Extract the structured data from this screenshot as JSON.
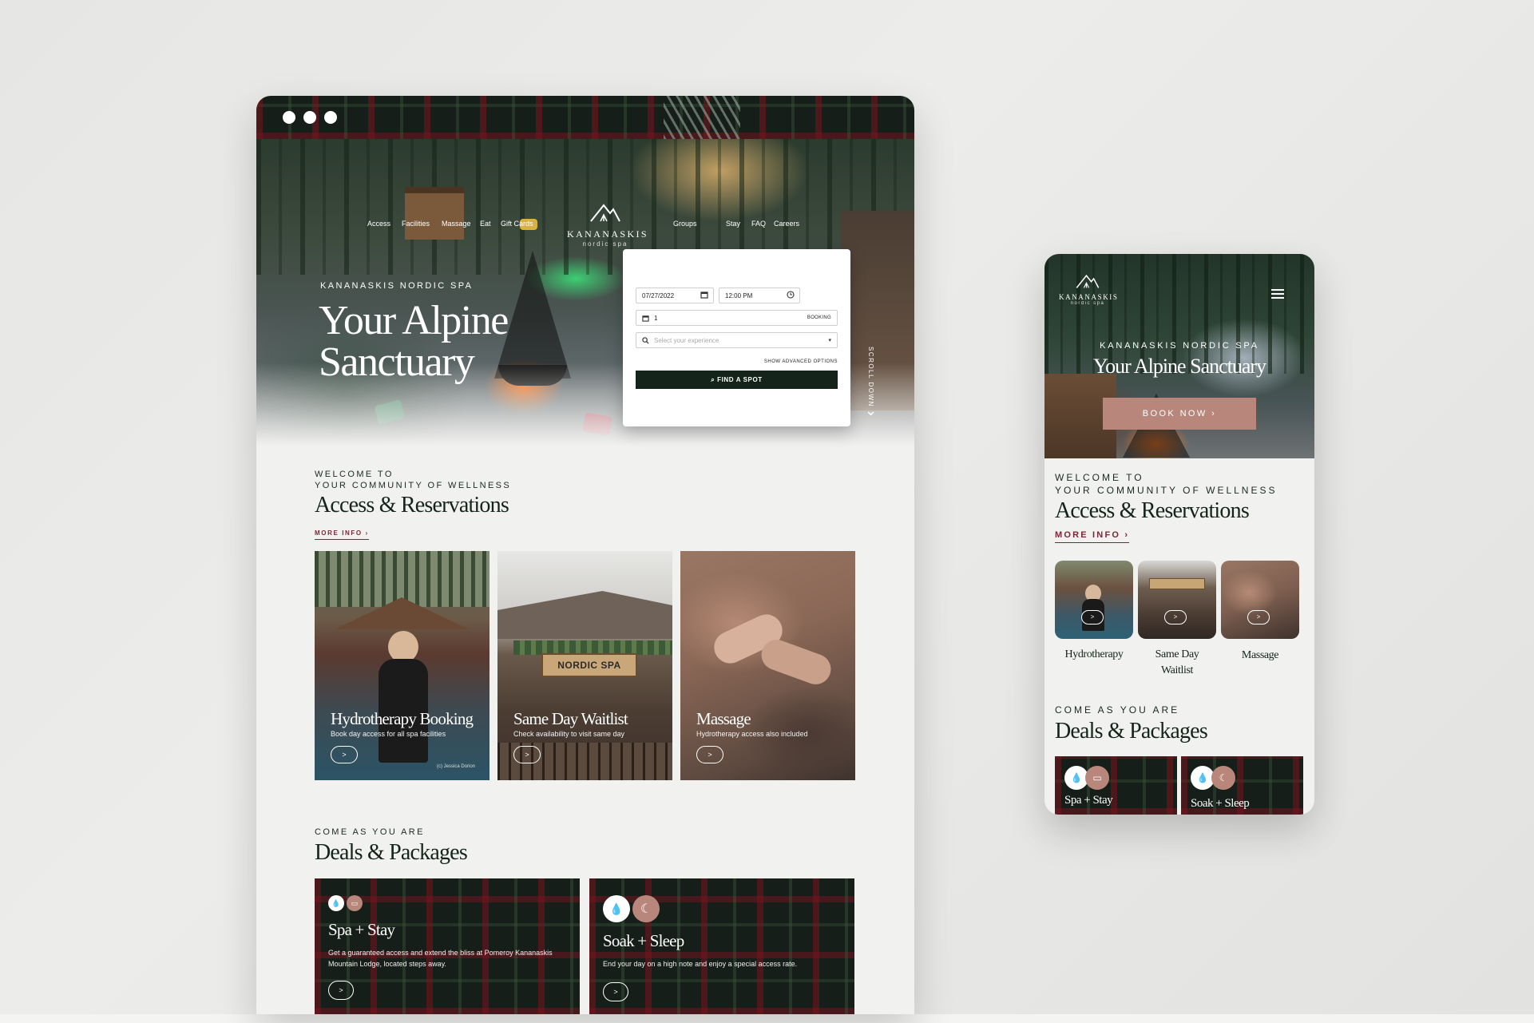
{
  "desktop": {
    "nav": {
      "left": [
        "Access",
        "Facilities",
        "Massage",
        "Eat",
        "Gift Cards"
      ],
      "right": [
        "Groups",
        "Stay",
        "FAQ",
        "Careers"
      ]
    },
    "logo": {
      "word": "KANANASKIS",
      "sub": "nordic spa"
    },
    "hero": {
      "eyebrow": "KANANASKIS NORDIC SPA",
      "title": "Your Alpine Sanctuary",
      "scroll_label": "SCROLL DOWN"
    },
    "booking": {
      "date_value": "07/27/2022",
      "time_value": "12:00 PM",
      "guests_value": "1",
      "guests_suffix": "BOOKING",
      "experience_placeholder": "Select your experience",
      "advanced_label": "SHOW ADVANCED OPTIONS",
      "find_label": "FIND A SPOT"
    },
    "access": {
      "eyebrow_line1": "WELCOME TO",
      "eyebrow_line2": "YOUR COMMUNITY OF WELLNESS",
      "title": "Access & Reservations",
      "more_info": "MORE INFO"
    },
    "cards": [
      {
        "title": "Hydrotherapy Booking",
        "desc": "Book day access for all spa facilities",
        "credit": "(c) Jessica Dorion"
      },
      {
        "title": "Same Day Waitlist",
        "desc": "Check availability to visit same day"
      },
      {
        "title": "Massage",
        "desc": "Hydrotherapy access also included"
      }
    ],
    "card_button": ">",
    "deals": {
      "eyebrow": "COME AS YOU ARE",
      "title": "Deals & Packages",
      "items": [
        {
          "title": "Spa + Stay",
          "text": "Get a guaranteed access and extend the bliss at Pomeroy Kananaskis Mountain Lodge, located steps away."
        },
        {
          "title": "Soak + Sleep",
          "text": "End your day on a high note and enjoy a special access rate."
        }
      ]
    }
  },
  "sign": {
    "text": "NORDIC SPA"
  },
  "mobile": {
    "logo": {
      "word": "KANANASKIS",
      "sub": "nordic spa"
    },
    "hero": {
      "eyebrow": "KANANASKIS NORDIC SPA",
      "title": "Your Alpine Sanctuary",
      "book_label": "BOOK NOW"
    },
    "access": {
      "eyebrow_line1": "WELCOME TO",
      "eyebrow_line2": "YOUR COMMUNITY OF WELLNESS",
      "title": "Access & Reservations",
      "more_info": "MORE INFO"
    },
    "cards": [
      {
        "label_line1": "Hydrotherapy",
        "label_line2": ""
      },
      {
        "label_line1": "Same Day",
        "label_line2": "Waitlist"
      },
      {
        "label_line1": "Massage",
        "label_line2": ""
      }
    ],
    "deals": {
      "eyebrow": "COME AS YOU ARE",
      "title": "Deals & Packages",
      "items": [
        {
          "title": "Spa + Stay"
        },
        {
          "title": "Soak + Sleep"
        }
      ]
    }
  },
  "colors": {
    "forest": "#14241b",
    "burgundy": "#7b2636",
    "rose": "#b8867a",
    "page": "#f1f1ef"
  }
}
